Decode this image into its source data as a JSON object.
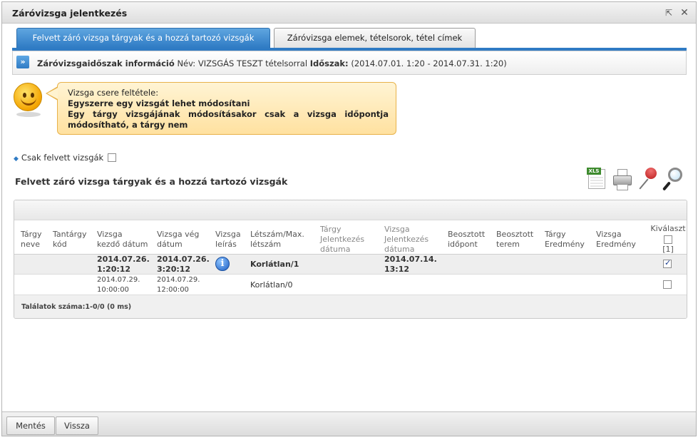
{
  "window": {
    "title": "Záróvizsga jelentkezés",
    "popout_icon": "popout-icon",
    "close_icon": "close-icon"
  },
  "tabs": [
    {
      "label": "Felvett záró vizsga tárgyak és a hozzá tartozó vizsgák",
      "active": true
    },
    {
      "label": "Záróvizsga elemek, tételsorok, tétel címek",
      "active": false
    }
  ],
  "infobar": {
    "label": "Záróvizsgaidőszak információ",
    "name_label": "Név:",
    "name_value": "VIZSGÁS TESZT tételsorral",
    "period_label": "Időszak:",
    "period_value": "(2014.07.01. 1:20 - 2014.07.31. 1:20)"
  },
  "notice": {
    "line1": "Vizsga csere feltétele:",
    "line2": "Egyszerre egy vizsgát lehet módosítani",
    "line3": "Egy tárgy vizsgájának módosításakor csak a vizsga időpontja",
    "line4": "módosítható, a tárgy nem"
  },
  "filter": {
    "label": "Csak felvett vizsgák",
    "checked": false
  },
  "section_title": "Felvett záró vizsga tárgyak és a hozzá tartozó vizsgák",
  "toolbar": [
    "excel-export-icon",
    "print-icon",
    "pin-icon",
    "search-icon"
  ],
  "toolbar_xls_label": "XLS",
  "table": {
    "headers": {
      "targy_neve": [
        "Tárgy",
        "neve"
      ],
      "tantargy_kod": [
        "Tantárgy",
        "kód"
      ],
      "kezdo": [
        "Vizsga",
        "kezdő dátum"
      ],
      "veg": [
        "Vizsga vég",
        "dátum"
      ],
      "leiras": [
        "Vizsga",
        "leírás"
      ],
      "letszam": [
        "Létszám/Max.",
        "létszám"
      ],
      "targy_jel": [
        "Tárgy",
        "Jelentkezés",
        "dátuma"
      ],
      "vizsga_jel": [
        "Vizsga",
        "Jelentkezés",
        "dátuma"
      ],
      "beo_idopont": [
        "Beosztott",
        "időpont"
      ],
      "beo_terem": [
        "Beosztott",
        "terem"
      ],
      "targy_eredmeny": [
        "Tárgy",
        "Eredmény"
      ],
      "vizsga_eredmeny": [
        "Vizsga",
        "Eredmény"
      ],
      "kivalaszt": "Kiválaszt",
      "kivalaszt_count": "[1]"
    },
    "rows": [
      {
        "kezdo": [
          "2014.07.26.",
          "1:20:12"
        ],
        "veg": [
          "2014.07.26.",
          "3:20:12"
        ],
        "letszam": "Korlátlan/1",
        "vizsga_jel": [
          "2014.07.14.",
          "13:12"
        ],
        "checked": true
      },
      {
        "kezdo": [
          "2014.07.29.",
          "10:00:00"
        ],
        "veg": [
          "2014.07.29.",
          "12:00:00"
        ],
        "letszam": "Korlátlan/0",
        "checked": false
      }
    ],
    "footer": "Találatok száma:1-0/0 (0 ms)"
  },
  "buttons": {
    "save": "Mentés",
    "back": "Vissza"
  }
}
